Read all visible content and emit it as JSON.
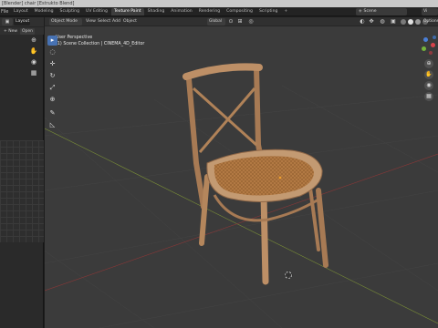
{
  "window": {
    "title": "[Blender] chair [Estrukto Blend]"
  },
  "topbar": {
    "menu_file": "File",
    "workspace_tabs": [
      "Layout",
      "Modeling",
      "Sculpting",
      "UV Editing",
      "Texture Paint",
      "Shading",
      "Animation",
      "Rendering",
      "Compositing",
      "Scripting"
    ],
    "active_tab": "Texture Paint",
    "more_tabs": "+",
    "scene_label": "Scene",
    "view_layer_label": "Vi"
  },
  "image_editor": {
    "mode_label": "",
    "layer_field": "Layout",
    "new_label": "+ New",
    "open_label": "Open",
    "tools": [
      "cursor",
      "scale",
      "pan",
      "zoom"
    ]
  },
  "viewport": {
    "mode_label": "Object Mode",
    "menus": [
      "View",
      "Select",
      "Add",
      "Object"
    ],
    "orientation_label": "Global",
    "options_label": "Options",
    "overlay_line1": "User Perspective",
    "overlay_line2": "(1) Scene Collection | CINEMA_4D_Editor",
    "tools": [
      "select-box",
      "cursor",
      "move",
      "rotate",
      "scale",
      "transform",
      "annotate",
      "measure"
    ]
  },
  "colors": {
    "viewport_bg": "#3b3b3b",
    "grid_line": "#444444",
    "x_axis": "#8b3b3b",
    "y_axis": "#6f8a2f",
    "chair_wood": "#b98b62",
    "chair_shadow": "#8f6747",
    "seat_weave": "#b57b45",
    "accent": "#4772b3"
  }
}
